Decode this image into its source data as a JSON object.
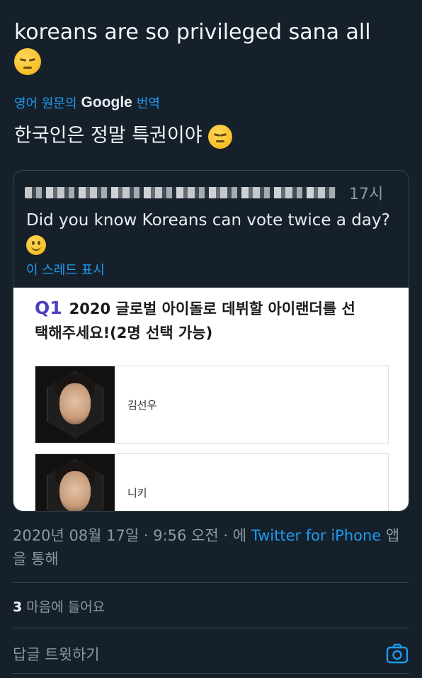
{
  "tweet": {
    "text": "koreans are so privileged sana all",
    "emoji": "pensive-face",
    "translated_prefix": "영어 원문의",
    "translated_brand": "Google",
    "translated_suffix": "번역",
    "translation": "한국인은 정말 특권이야"
  },
  "quote": {
    "time": "17시",
    "text": "Did you know Koreans can vote twice a day?",
    "emoji": "slightly-smiling-face",
    "show_thread": "이 스레드 표시",
    "poll": {
      "question_number": "Q1",
      "question": "2020 글로벌 아이돌로 데뷔할 아이랜더를 선택해주세요!(2명 선택 가능)",
      "candidates": [
        {
          "name": "김선우"
        },
        {
          "name": "니키"
        }
      ]
    }
  },
  "meta": {
    "timestamp": "2020년 08월 17일 · 9:56 오전 · 에",
    "source": "Twitter for iPhone",
    "via": "앱을 통해"
  },
  "likes": {
    "count": "3",
    "label": "마음에 들어요"
  },
  "reply": {
    "placeholder": "답글 트윗하기"
  },
  "colors": {
    "background": "#15202b",
    "link": "#1d9bf0",
    "muted": "#8b98a5"
  }
}
